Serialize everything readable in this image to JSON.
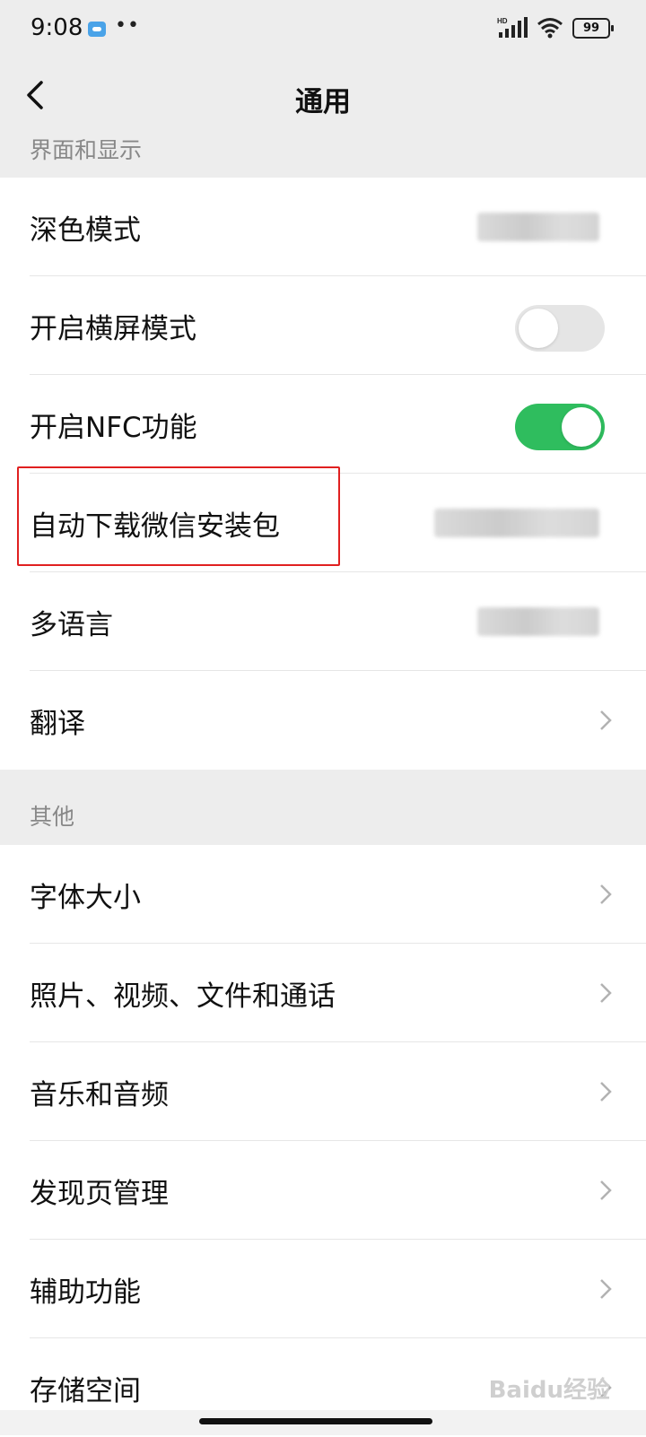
{
  "status_bar": {
    "time": "9:08",
    "dots": "••",
    "battery": "99",
    "hd_label": "HD"
  },
  "nav": {
    "title": "通用"
  },
  "sections": {
    "display": {
      "header": "界面和显示",
      "items": [
        {
          "label": "深色模式"
        },
        {
          "label": "开启横屏模式",
          "toggle": "off"
        },
        {
          "label": "开启NFC功能",
          "toggle": "on"
        },
        {
          "label": "自动下载微信安装包"
        },
        {
          "label": "多语言"
        },
        {
          "label": "翻译"
        }
      ]
    },
    "other": {
      "header": "其他",
      "items": [
        {
          "label": "字体大小"
        },
        {
          "label": "照片、视频、文件和通话"
        },
        {
          "label": "音乐和音频"
        },
        {
          "label": "发现页管理"
        },
        {
          "label": "辅助功能"
        },
        {
          "label": "存储空间"
        }
      ]
    }
  },
  "watermark": "Baidu经验",
  "colors": {
    "toggle_on": "#2fbd5e",
    "toggle_off": "#e5e5e5",
    "highlight": "#e02020",
    "background": "#ededed"
  }
}
